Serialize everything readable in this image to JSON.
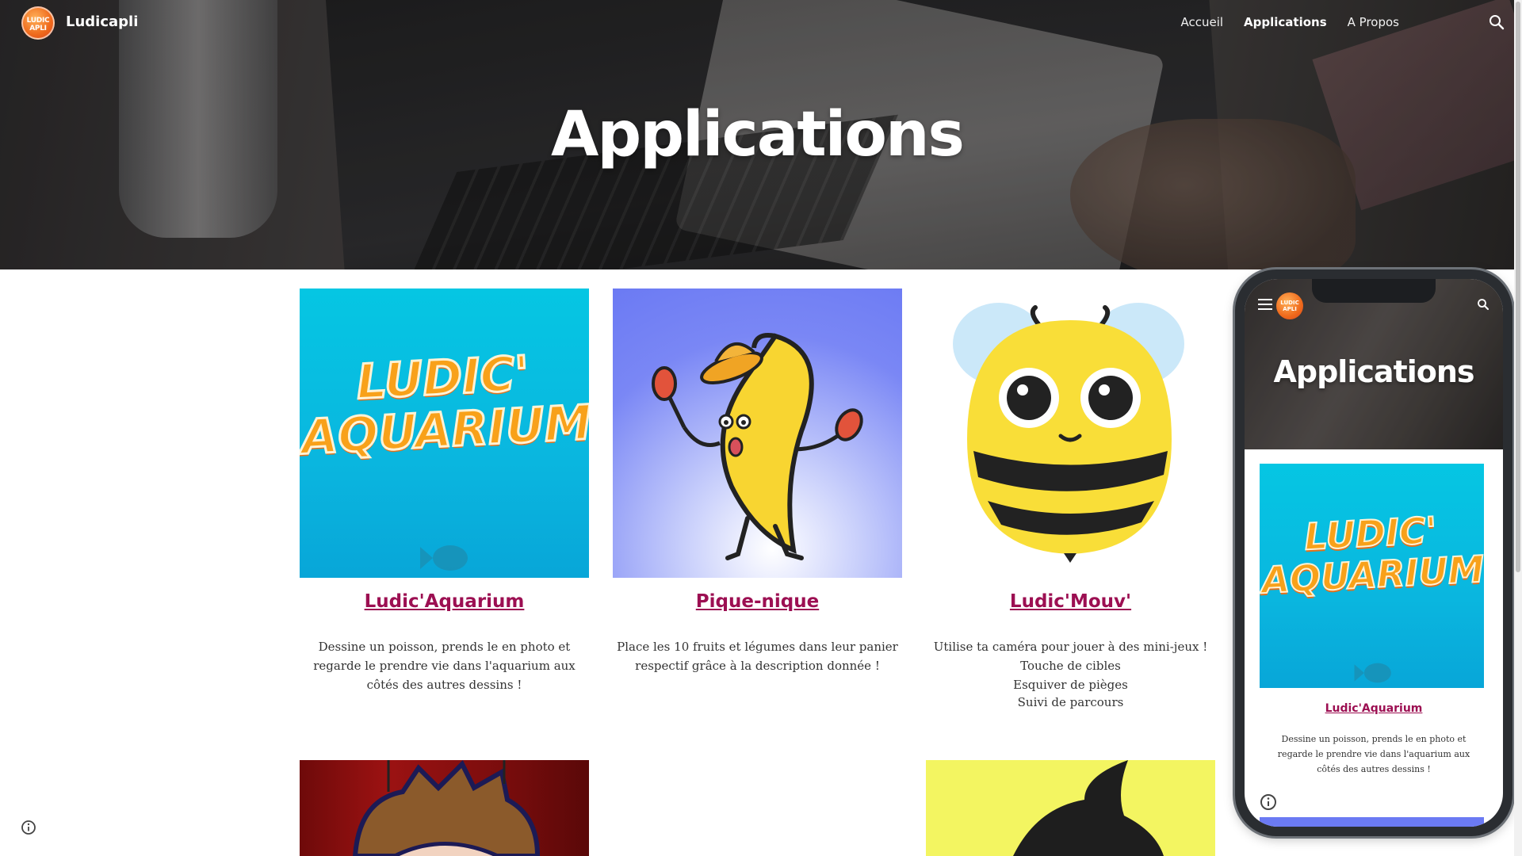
{
  "site": {
    "logo_text": "LUDIC APLI",
    "name": "Ludicapli"
  },
  "nav": {
    "items": [
      {
        "label": "Accueil",
        "active": false
      },
      {
        "label": "Applications",
        "active": true
      },
      {
        "label": "A Propos",
        "active": false
      }
    ],
    "search_icon": "search-icon"
  },
  "hero": {
    "title": "Applications"
  },
  "cards": [
    {
      "title": "Ludic'Aquarium",
      "thumb_text_line1": "LUDIC'",
      "thumb_text_line2": "AQUARIUM",
      "desc_lines": [
        "Dessine un poisson, prends le en photo et",
        "regarde le prendre vie dans l'aquarium aux",
        "côtés des autres dessins !"
      ]
    },
    {
      "title": "Pique-nique ",
      "desc_lines": [
        "Place les 10 fruits et légumes dans leur panier",
        "respectif grâce à la description donnée !"
      ]
    },
    {
      "title": "Ludic'Mouv'",
      "desc_lines": [
        "Utilise ta caméra pour jouer à des mini-jeux !",
        "Touche de cibles",
        "Esquiver de pièges",
        "Suivi de parcours"
      ]
    }
  ],
  "phone_preview": {
    "title": "Applications",
    "logo_text": "LUDIC APLI",
    "card_title": "Ludic'Aquarium",
    "desc_lines": [
      "Dessine un poisson, prends le en photo et",
      "regarde le prendre vie dans l'aquarium aux",
      "côtés des autres dessins !"
    ]
  },
  "colors": {
    "link": "#9c0f52",
    "aquarium_bg": "#05c6e3",
    "banana_bg": "#6b7af3",
    "theater_bg": "#9c1212",
    "yellow_bg": "#f3f561"
  }
}
